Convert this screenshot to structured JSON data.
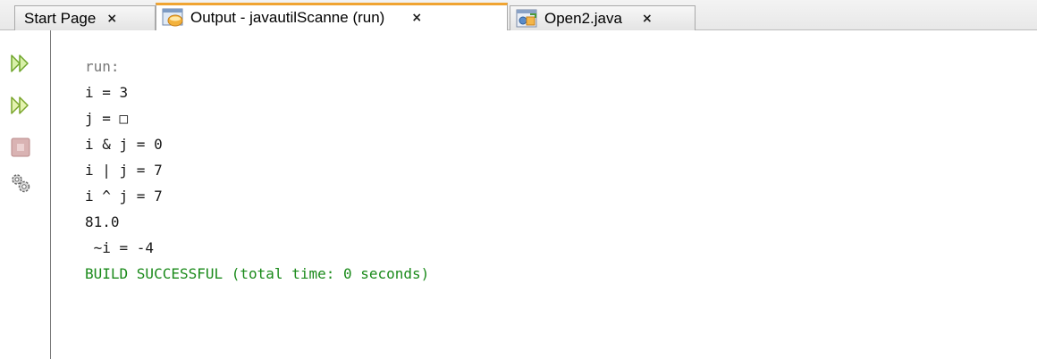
{
  "tabs": [
    {
      "label": "Start Page",
      "close": "×",
      "icon": "none"
    },
    {
      "label": "Output - javautilScanne (run)",
      "close": "×",
      "icon": "output-window-icon",
      "active": true
    },
    {
      "label": "Open2.java",
      "close": "×",
      "icon": "java-file-icon"
    }
  ],
  "toolbar": {
    "buttons": [
      {
        "name": "rerun-icon",
        "color": "#8bc34a"
      },
      {
        "name": "rerun-with-options-icon",
        "color": "#8bc34a"
      },
      {
        "name": "stop-icon",
        "color": "#c98a8a"
      },
      {
        "name": "settings-icon",
        "color": "#707070"
      }
    ]
  },
  "console": {
    "lines": [
      {
        "text": "run:",
        "style": "gray"
      },
      {
        "text": "i = 3",
        "style": "normal"
      },
      {
        "text": "j = □",
        "style": "normal"
      },
      {
        "text": "i & j = 0",
        "style": "normal"
      },
      {
        "text": "i | j = 7",
        "style": "normal"
      },
      {
        "text": "i ^ j = 7",
        "style": "normal"
      },
      {
        "text": "81.0",
        "style": "normal"
      },
      {
        "text": " ~i = -4",
        "style": "normal"
      },
      {
        "text": "BUILD SUCCESSFUL (total time: 0 seconds)",
        "style": "green"
      }
    ]
  },
  "colors": {
    "active_tab_accent": "#f0a432",
    "success_text": "#1a8a1a",
    "run_text": "#777777"
  }
}
